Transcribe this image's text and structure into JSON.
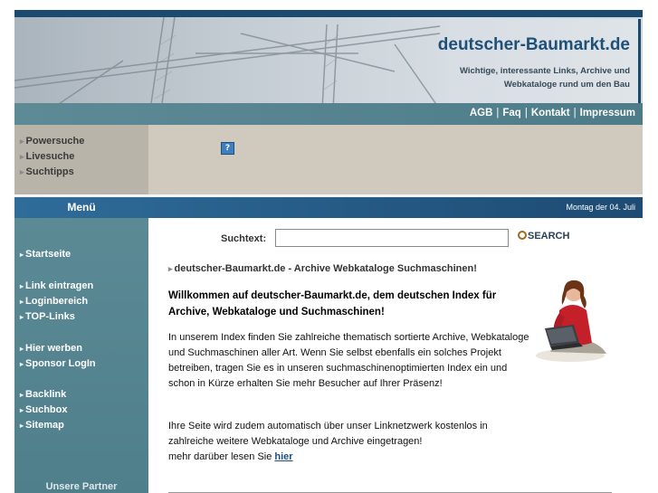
{
  "header": {
    "title": "deutscher-Baumarkt.de",
    "subtitle": "Wichtige, interessante Links, Archive und Webkataloge rund um den Bau"
  },
  "topnav": {
    "items": [
      "AGB",
      "Faq",
      "Kontakt",
      "Impressum"
    ],
    "separator": "|"
  },
  "subnav": {
    "items": [
      "Powersuche",
      "Livesuche",
      "Suchtipps"
    ],
    "help_icon": "?"
  },
  "menubar": {
    "menu_label": "Menü",
    "date": "Montag der 04. Juli"
  },
  "sidebar": {
    "groups": [
      [
        "Startseite"
      ],
      [
        "Link eintragen",
        "Loginbereich",
        "TOP-Links"
      ],
      [
        "Hier werben",
        "Sponsor LogIn"
      ],
      [
        "Backlink",
        "Suchbox",
        "Sitemap"
      ]
    ],
    "partner_label": "Unsere Partner"
  },
  "search": {
    "label": "Suchtext:",
    "value": "",
    "button_label": "SEARCH"
  },
  "content": {
    "title": "deutscher-Baumarkt.de - Archive Webkataloge Suchmaschinen!",
    "welcome": "Willkommen auf deutscher-Baumarkt.de, dem deutschen Index für Archive, Webkataloge und Suchmaschinen!",
    "para1": "In unserem Index finden Sie zahlreiche thematisch sortierte Archive, Webkataloge und Suchmaschinen aller Art. Wenn Sie selbst ebenfalls ein solches Projekt betreiben, tragen Sie es in unseren suchmaschinenoptimierten Index ein und schon in Kürze erhalten Sie mehr Besucher auf Ihrer Präsenz!",
    "para2": "Ihre Seite wird zudem automatisch über unser Linknetzwerk kostenlos in zahlreiche weitere Webkataloge und Archive eingetragen!",
    "more_text": "mehr darüber lesen Sie",
    "more_link": "hier"
  },
  "colors": {
    "dark_blue": "#1c4a6e",
    "teal": "#5b8a95",
    "beige": "#cfcabd"
  }
}
